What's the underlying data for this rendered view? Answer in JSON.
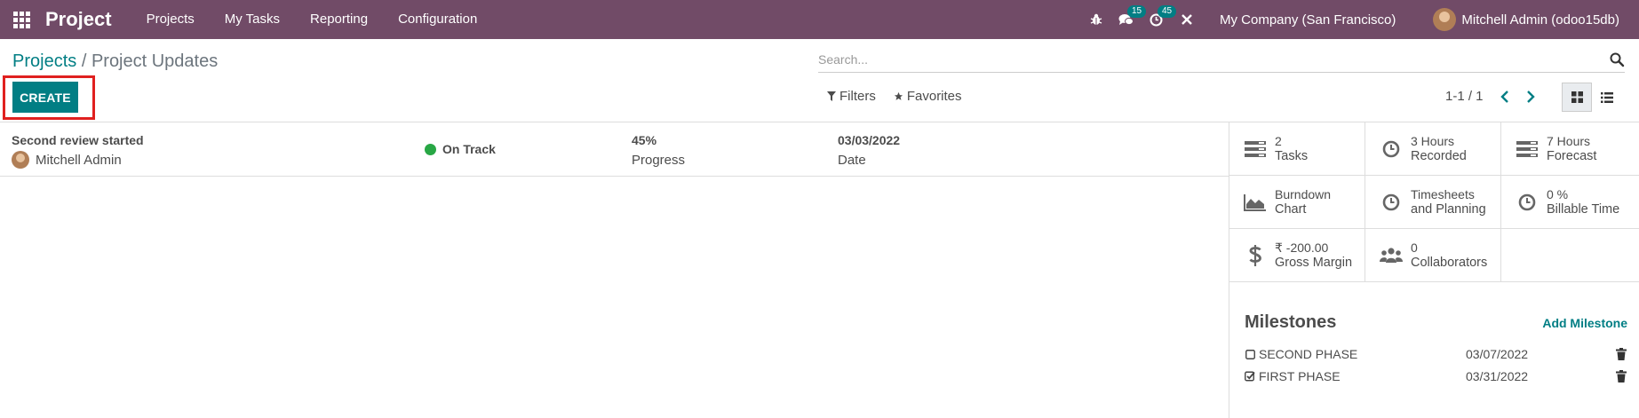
{
  "navbar": {
    "brand": "Project",
    "menus": [
      "Projects",
      "My Tasks",
      "Reporting",
      "Configuration"
    ],
    "chat_count": "15",
    "activity_count": "45",
    "company": "My Company (San Francisco)",
    "user": "Mitchell Admin (odoo15db)"
  },
  "breadcrumb": {
    "parent": "Projects",
    "separator": "/",
    "current": "Project Updates"
  },
  "search": {
    "placeholder": "Search..."
  },
  "toolbar": {
    "create_label": "CREATE",
    "filters_label": "Filters",
    "favorites_label": "Favorites",
    "pager": "1-1 / 1"
  },
  "update": {
    "title": "Second review started",
    "user": "Mitchell Admin",
    "status": "On Track",
    "status_color": "#28a745",
    "progress_value": "45%",
    "progress_label": "Progress",
    "date_value": "03/03/2022",
    "date_label": "Date"
  },
  "stats": [
    {
      "icon": "tasks-icon",
      "value": "2",
      "label": "Tasks"
    },
    {
      "icon": "clock-icon",
      "value": "3 Hours",
      "label": "Recorded"
    },
    {
      "icon": "tasks-icon",
      "value": "7 Hours",
      "label": "Forecast"
    },
    {
      "icon": "area-chart-icon",
      "value": "Burndown",
      "label": "Chart"
    },
    {
      "icon": "clock-icon",
      "value": "Timesheets",
      "label": "and Planning"
    },
    {
      "icon": "clock-icon",
      "value": "0 %",
      "label": "Billable Time"
    },
    {
      "icon": "dollar-icon",
      "value": "₹ -200.00",
      "label": "Gross Margin"
    },
    {
      "icon": "users-icon",
      "value": "0",
      "label": "Collaborators"
    }
  ],
  "milestones": {
    "title": "Milestones",
    "add_label": "Add Milestone",
    "items": [
      {
        "name": "SECOND PHASE",
        "date": "03/07/2022",
        "done": false
      },
      {
        "name": "FIRST PHASE",
        "date": "03/31/2022",
        "done": true
      }
    ]
  },
  "colors": {
    "navbar": "#714b67",
    "primary": "#017e84",
    "highlight": "#e0201f"
  }
}
